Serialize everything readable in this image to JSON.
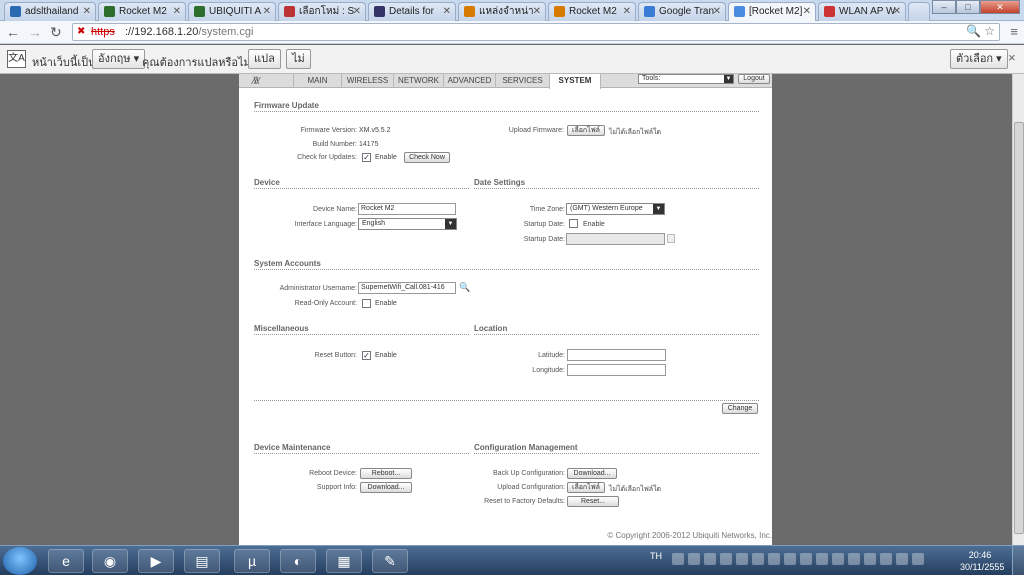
{
  "browser": {
    "tabs": [
      {
        "label": "adslthailand",
        "color": "#2a6ab3"
      },
      {
        "label": "Rocket M2",
        "color": "#2d6e2d"
      },
      {
        "label": "UBIQUITI A",
        "color": "#2d6e2d"
      },
      {
        "label": "เลือกโหม่ : S",
        "color": "#b33"
      },
      {
        "label": "Details for",
        "color": "#336"
      },
      {
        "label": "แหล่งจำหน่า",
        "color": "#d67a00"
      },
      {
        "label": "Rocket M2",
        "color": "#d67a00"
      },
      {
        "label": "Google Tran",
        "color": "#3a7bd5"
      },
      {
        "label": "[Rocket M2]",
        "color": "#4a8de0"
      },
      {
        "label": "WLAN AP W",
        "color": "#c33"
      }
    ],
    "url_protocol": "https",
    "url_host": "://192.168.1.20",
    "url_path": "/system.cgi"
  },
  "translate_bar": {
    "prefix": "หน้าเว็บนี้เป็น",
    "language": "อังกฤษ ▾",
    "question": "คุณต้องการแปลหรือไม่",
    "translate_btn": "แปล",
    "no_btn": "ไม่",
    "options_btn": "ตัวเลือก ▾",
    "close": "×"
  },
  "nav": {
    "tabs": [
      "MAIN",
      "WIRELESS",
      "NETWORK",
      "ADVANCED",
      "SERVICES",
      "SYSTEM"
    ],
    "tools_label": "Tools:",
    "logout": "Logout"
  },
  "firmware": {
    "title": "Firmware Update",
    "version_label": "Firmware Version:",
    "version": "XM.v5.5.2",
    "build_label": "Build Number:",
    "build": "14175",
    "check_label": "Check for Updates:",
    "check_enable": "Enable",
    "check_now": "Check Now",
    "upload_label": "Upload Firmware:",
    "choose_file": "เลือกไฟล์",
    "no_file": "ไม่ได้เลือกไฟล์ใด"
  },
  "device": {
    "title": "Device",
    "name_label": "Device Name:",
    "name": "Rocket M2",
    "lang_label": "Interface Language:",
    "lang": "English"
  },
  "date": {
    "title": "Date Settings",
    "tz_label": "Time Zone:",
    "tz": "(GMT) Western Europe",
    "startup_label": "Startup Date:",
    "startup_enable": "Enable",
    "startup_date_label": "Startup Date:"
  },
  "accounts": {
    "title": "System Accounts",
    "admin_label": "Administrator Username:",
    "admin": "SupernetWifi_Call.081-416",
    "ro_label": "Read-Only Account:",
    "ro_enable": "Enable"
  },
  "misc": {
    "title": "Miscellaneous",
    "reset_label": "Reset Button:",
    "reset_enable": "Enable"
  },
  "location": {
    "title": "Location",
    "lat_label": "Latitude:",
    "lon_label": "Longitude:"
  },
  "change_btn": "Change",
  "maintenance": {
    "title": "Device Maintenance",
    "reboot_label": "Reboot Device:",
    "reboot_btn": "Reboot...",
    "support_label": "Support Info:",
    "support_btn": "Download..."
  },
  "config": {
    "title": "Configuration Management",
    "backup_label": "Back Up Configuration:",
    "backup_btn": "Download...",
    "upload_label": "Upload Configuration:",
    "choose_file": "เลือกไฟล์",
    "no_file": "ไม่ได้เลือกไฟล์ใด",
    "reset_label": "Reset to Factory Defaults:",
    "reset_btn": "Reset..."
  },
  "footer": "© Copyright 2006-2012 Ubiquiti Networks, Inc.",
  "taskbar": {
    "lang": "TH",
    "time": "20:46",
    "date": "30/11/2555"
  }
}
